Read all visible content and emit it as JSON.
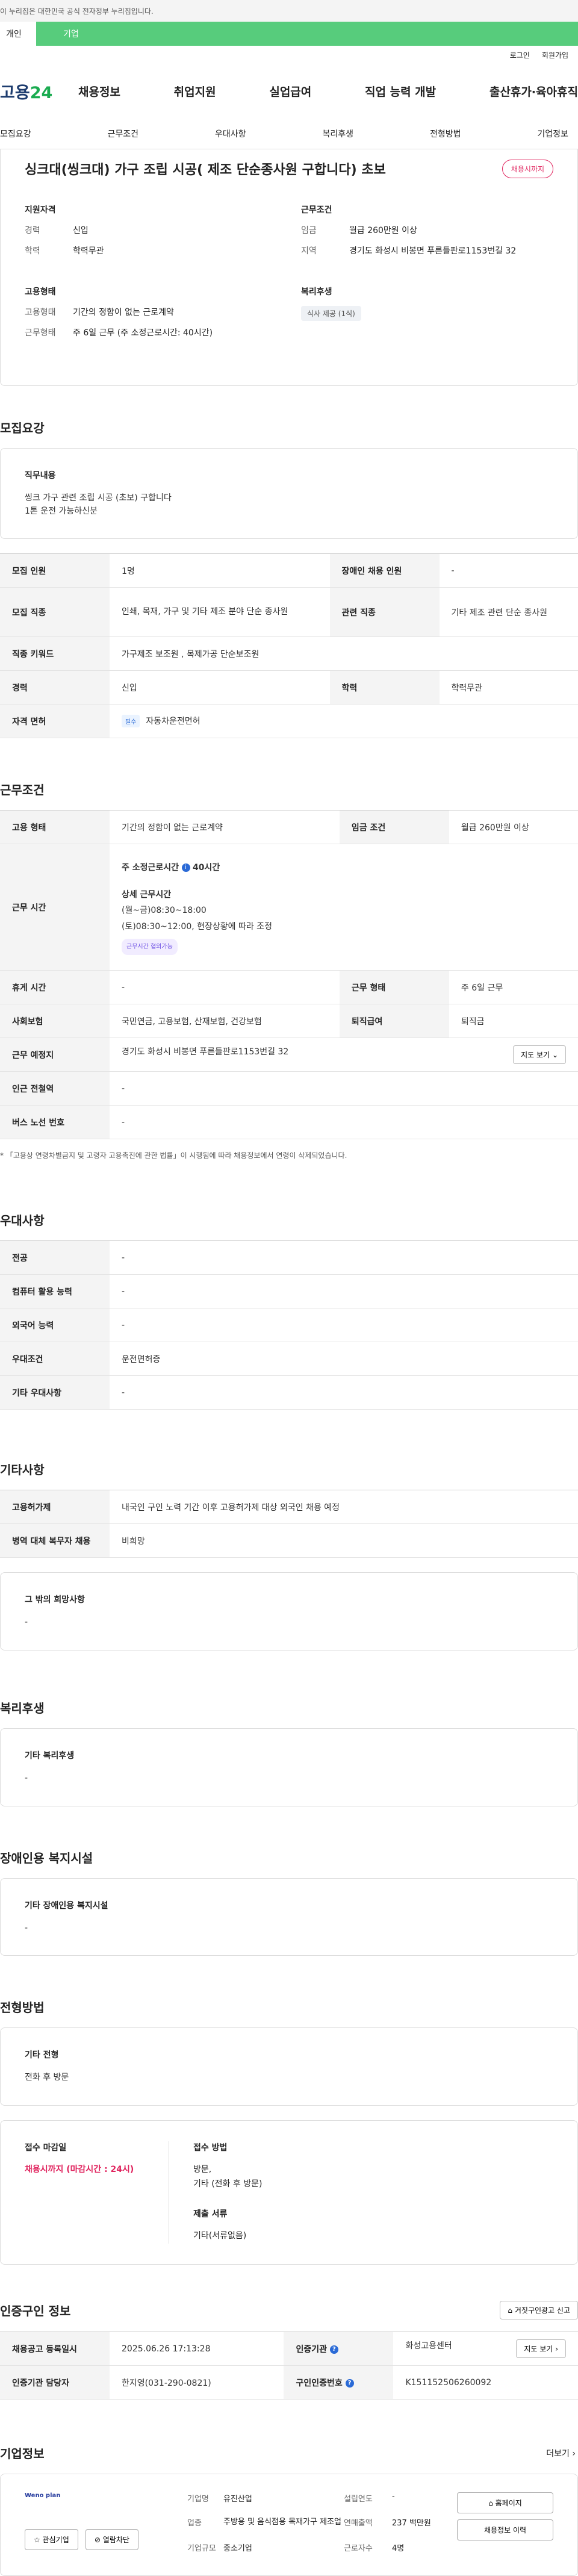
{
  "gov_bar": "이 누리집은 대한민국 공식 전자정부 누리집입니다.",
  "tabs": {
    "individual": "개인",
    "company": "기업"
  },
  "util": {
    "login": "로그인",
    "join": "회원가입"
  },
  "logo": {
    "text": "고용",
    "num": "24"
  },
  "gnb": [
    "채용정보",
    "취업지원",
    "실업급여",
    "직업 능력 개발",
    "출산휴가·육아휴직"
  ],
  "anchor": [
    "모집요강",
    "근무조건",
    "우대사항",
    "복리후생",
    "전형방법",
    "기업정보"
  ],
  "summary": {
    "title": "싱크대(씽크대) 가구 조립 시공( 제조 단순종사원 구합니다) 초보",
    "status": "채용시까지",
    "qual_h": "지원자격",
    "career_k": "경력",
    "career_v": "신입",
    "edu_k": "학력",
    "edu_v": "학력무관",
    "cond_h": "근무조건",
    "wage_k": "임금",
    "wage_v": "월급 260만원 이상",
    "area_k": "지역",
    "area_v": "경기도 화성시 비봉면 푸른들판로1153번길 32",
    "type_h": "고용형태",
    "emp_k": "고용형태",
    "emp_v": "기간의 정함이 없는 근로계약",
    "work_k": "근무형태",
    "work_v": "주 6일 근무 (주 소정근로시간: 40시간)",
    "welfare_h": "복리후생",
    "welfare_chip": "식사 제공 (1식)"
  },
  "recruit": {
    "title": "모집요강",
    "duty_h": "직무내용",
    "duty_1": "씽크 가구 관련 조립 시공 (초보) 구합니다",
    "duty_2": "1톤 운전 가능하신분",
    "rows": {
      "count_k": "모집 인원",
      "count_v": "1명",
      "disabled_k": "장애인 채용 인원",
      "disabled_v": "-",
      "job_k": "모집 직종",
      "job_v": "인쇄, 목재, 가구 및 기타 제조 분야 단순 종사원",
      "rel_k": "관련 직종",
      "rel_v": "기타 제조 관련 단순 종사원",
      "kw_k": "직종 키워드",
      "kw_v": "가구제조 보조원 , 목제가공 단순보조원",
      "exp_k": "경력",
      "exp_v": "신입",
      "edu_k": "학력",
      "edu_v": "학력무관",
      "lic_k": "자격 면허",
      "lic_chip": "필수",
      "lic_v": "자동차운전면허"
    }
  },
  "work": {
    "title": "근무조건",
    "emp_k": "고용 형태",
    "emp_v": "기간의 정함이 없는 근로계약",
    "wage_k": "임금 조건",
    "wage_v": "월급 260만원 이상",
    "time_k": "근무 시간",
    "time_h": "주 소정근로시간",
    "time_hours": "40시간",
    "detail_h": "상세 근무시간",
    "detail_1": "(월~금)08:30~18:00",
    "detail_2": "(토)08:30~12:00, 현장상황에 따라 조정",
    "flex_chip": "근무시간 협의가능",
    "rest_k": "휴게 시간",
    "rest_v": "-",
    "form_k": "근무 형태",
    "form_v": "주 6일 근무",
    "ins_k": "사회보험",
    "ins_v": "국민연금, 고용보험, 산재보험, 건강보험",
    "ret_k": "퇴직급여",
    "ret_v": "퇴직금",
    "place_k": "근무 예정지",
    "place_v": "경기도 화성시 비봉면 푸른들판로1153번길 32",
    "map_btn": "지도 보기",
    "sub_k": "인근 전철역",
    "sub_v": "-",
    "bus_k": "버스 노선 번호",
    "bus_v": "-",
    "note": "* 「고용상 연령차별금지 및 고령자 고용촉진에 관한 법률」이 시행됨에 따라 채용정보에서 연령이 삭제되었습니다."
  },
  "pref": {
    "title": "우대사항",
    "major_k": "전공",
    "major_v": "-",
    "pc_k": "컴퓨터 활용 능력",
    "pc_v": "-",
    "lang_k": "외국어 능력",
    "lang_v": "-",
    "cond_k": "우대조건",
    "cond_v": "운전면허증",
    "etc_k": "기타 우대사항",
    "etc_v": "-"
  },
  "etc": {
    "title": "기타사항",
    "foreign_k": "고용허가제",
    "foreign_v": "내국인 구인 노력 기간 이후 고용허가제 대상 외국인 채용 예정",
    "mil_k": "병역 대체 복무자 채용",
    "mil_v": "비희망",
    "other_h": "그 밖의 희망사항",
    "other_v": "-"
  },
  "welfare": {
    "title": "복리후생",
    "h": "기타 복리후생",
    "v": "-"
  },
  "disabled": {
    "title": "장애인용 복지시설",
    "h": "기타 장애인용 복지시설",
    "v": "-"
  },
  "process": {
    "title": "전형방법",
    "h": "기타 전형",
    "v": "전화 후 방문",
    "deadline_h": "접수 마감일",
    "deadline_v": "채용시까지 (마감시간 : 24시)",
    "method_h": "접수 방법",
    "method_1": "방문,",
    "method_2": "기타 (전화 후 방문)",
    "docs_h": "제출 서류",
    "docs_v": "기타(서류없음)"
  },
  "agency": {
    "title": "인증구인 정보",
    "report_btn": "거짓구인광고 신고",
    "reg_k": "채용공고 등록일시",
    "reg_v": "2025.06.26 17:13:28",
    "org_k": "인증기관",
    "org_v": "화성고용센터",
    "map_btn": "지도 보기",
    "mgr_k": "인증기관 담당자",
    "mgr_v": "한지영(031-290-0821)",
    "no_k": "구인인증번호",
    "no_v": "K151152506260092"
  },
  "corp": {
    "title": "기업정보",
    "more": "더보기",
    "logo": "Weno plan",
    "interest_btn": "관심기업",
    "block_btn": "열람차단",
    "type_k": "기업명",
    "type_v": "유진산업",
    "ind_k": "업종",
    "ind_v": "주방용 및 음식점용 목재가구 제조업",
    "size_k": "기업규모",
    "size_v": "중소기업",
    "year_k": "설립연도",
    "year_v": "-",
    "sales_k": "연매출액",
    "sales_v": "237 백만원",
    "emp_k": "근로자수",
    "emp_v": "4명",
    "home_btn": "홈페이지",
    "jobs_btn": "채용정보 이력"
  }
}
